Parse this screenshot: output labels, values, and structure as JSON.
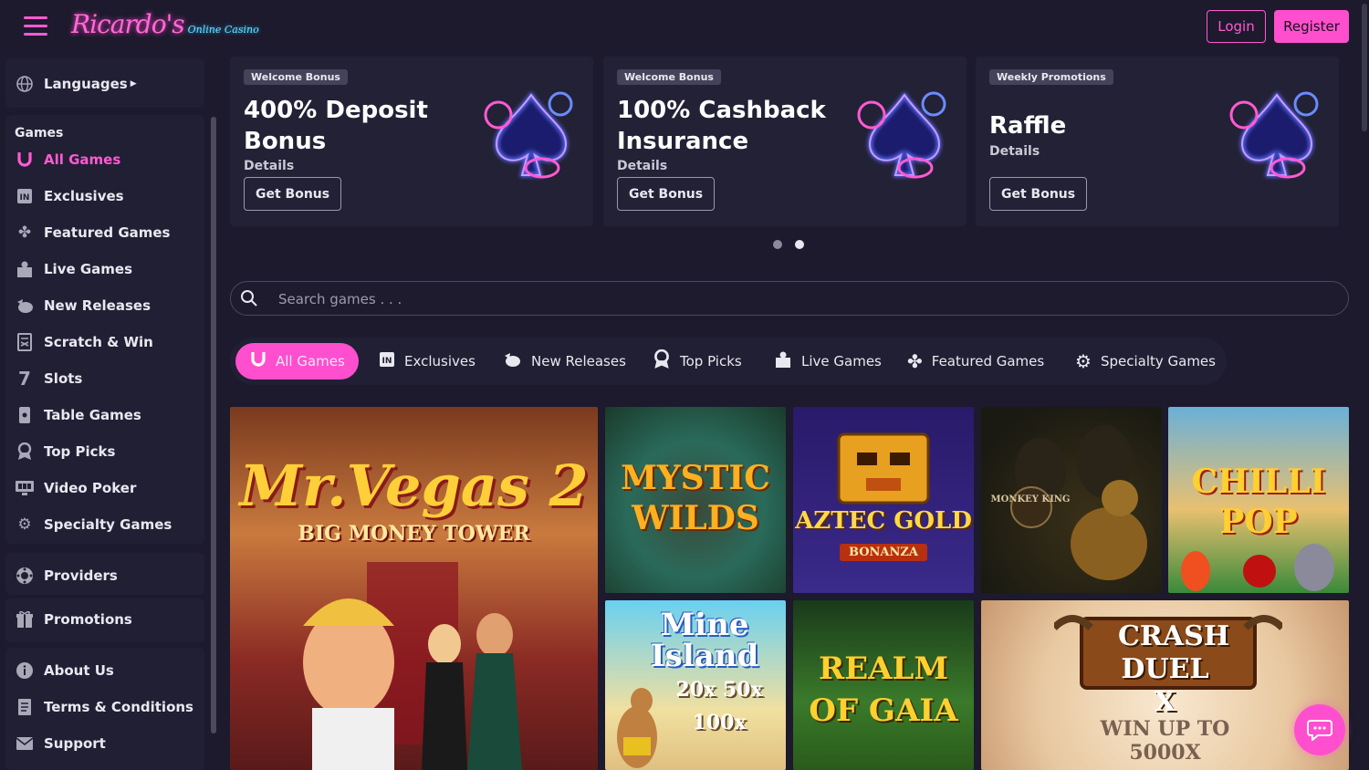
{
  "header": {
    "logo_main": "Ricardo's",
    "logo_sub": "Online Casino",
    "login_label": "Login",
    "register_label": "Register"
  },
  "sidebar": {
    "languages_label": "Languages",
    "games_heading": "Games",
    "items": [
      {
        "label": "All Games",
        "icon": "horseshoe-icon",
        "active": true
      },
      {
        "label": "Exclusives",
        "icon": "exclusive-icon"
      },
      {
        "label": "Featured Games",
        "icon": "clover-icon"
      },
      {
        "label": "Live Games",
        "icon": "live-dealer-icon"
      },
      {
        "label": "New Releases",
        "icon": "new-release-icon"
      },
      {
        "label": "Scratch & Win",
        "icon": "scratch-card-icon"
      },
      {
        "label": "Slots",
        "icon": "slot-seven-icon"
      },
      {
        "label": "Table Games",
        "icon": "table-games-icon"
      },
      {
        "label": "Top Picks",
        "icon": "medal-icon"
      },
      {
        "label": "Video Poker",
        "icon": "video-poker-icon"
      },
      {
        "label": "Specialty Games",
        "icon": "gear-icon"
      }
    ],
    "providers_label": "Providers",
    "promotions_label": "Promotions",
    "about_label": "About Us",
    "terms_label": "Terms & Conditions",
    "support_label": "Support"
  },
  "promos": [
    {
      "tag": "Welcome Bonus",
      "title_line1": "400% Deposit",
      "title_line2": "Bonus",
      "details": "Details",
      "cta": "Get Bonus"
    },
    {
      "tag": "Welcome Bonus",
      "title_line1": "100% Cashback",
      "title_line2": "Insurance",
      "details": "Details",
      "cta": "Get Bonus"
    },
    {
      "tag": "Weekly Promotions",
      "title_line1": "Raffle",
      "title_line2": "",
      "details": "Details",
      "cta": "Get Bonus"
    }
  ],
  "carousel": {
    "pages": 2,
    "active_page": 2
  },
  "search": {
    "placeholder": "Search games . . ."
  },
  "tabs": [
    {
      "label": "All Games",
      "icon": "horseshoe-icon",
      "active": true
    },
    {
      "label": "Exclusives",
      "icon": "exclusive-icon"
    },
    {
      "label": "New Releases",
      "icon": "new-release-icon"
    },
    {
      "label": "Top Picks",
      "icon": "medal-icon"
    },
    {
      "label": "Live Games",
      "icon": "live-dealer-icon"
    },
    {
      "label": "Featured Games",
      "icon": "clover-icon"
    },
    {
      "label": "Specialty Games",
      "icon": "gear-icon"
    }
  ],
  "games": [
    {
      "title": "Mr.Vegas 2",
      "subtitle": "BIG MONEY TOWER"
    },
    {
      "title": "MYSTIC WILDS",
      "subtitle": ""
    },
    {
      "title": "AZTEC GOLD",
      "subtitle": "BONANZA"
    },
    {
      "title": "MONKEY KING",
      "subtitle": ""
    },
    {
      "title": "CHILLI POP",
      "subtitle": ""
    },
    {
      "title": "Mine Island",
      "subtitle": "20x 50x 100x"
    },
    {
      "title": "REALM OF GAIA",
      "subtitle": ""
    },
    {
      "title": "CRASH DUEL X",
      "subtitle": "WIN UP TO 5000X"
    }
  ],
  "colors": {
    "accent": "#ff4fcf",
    "background": "#1c1a2c",
    "panel": "#232135"
  }
}
